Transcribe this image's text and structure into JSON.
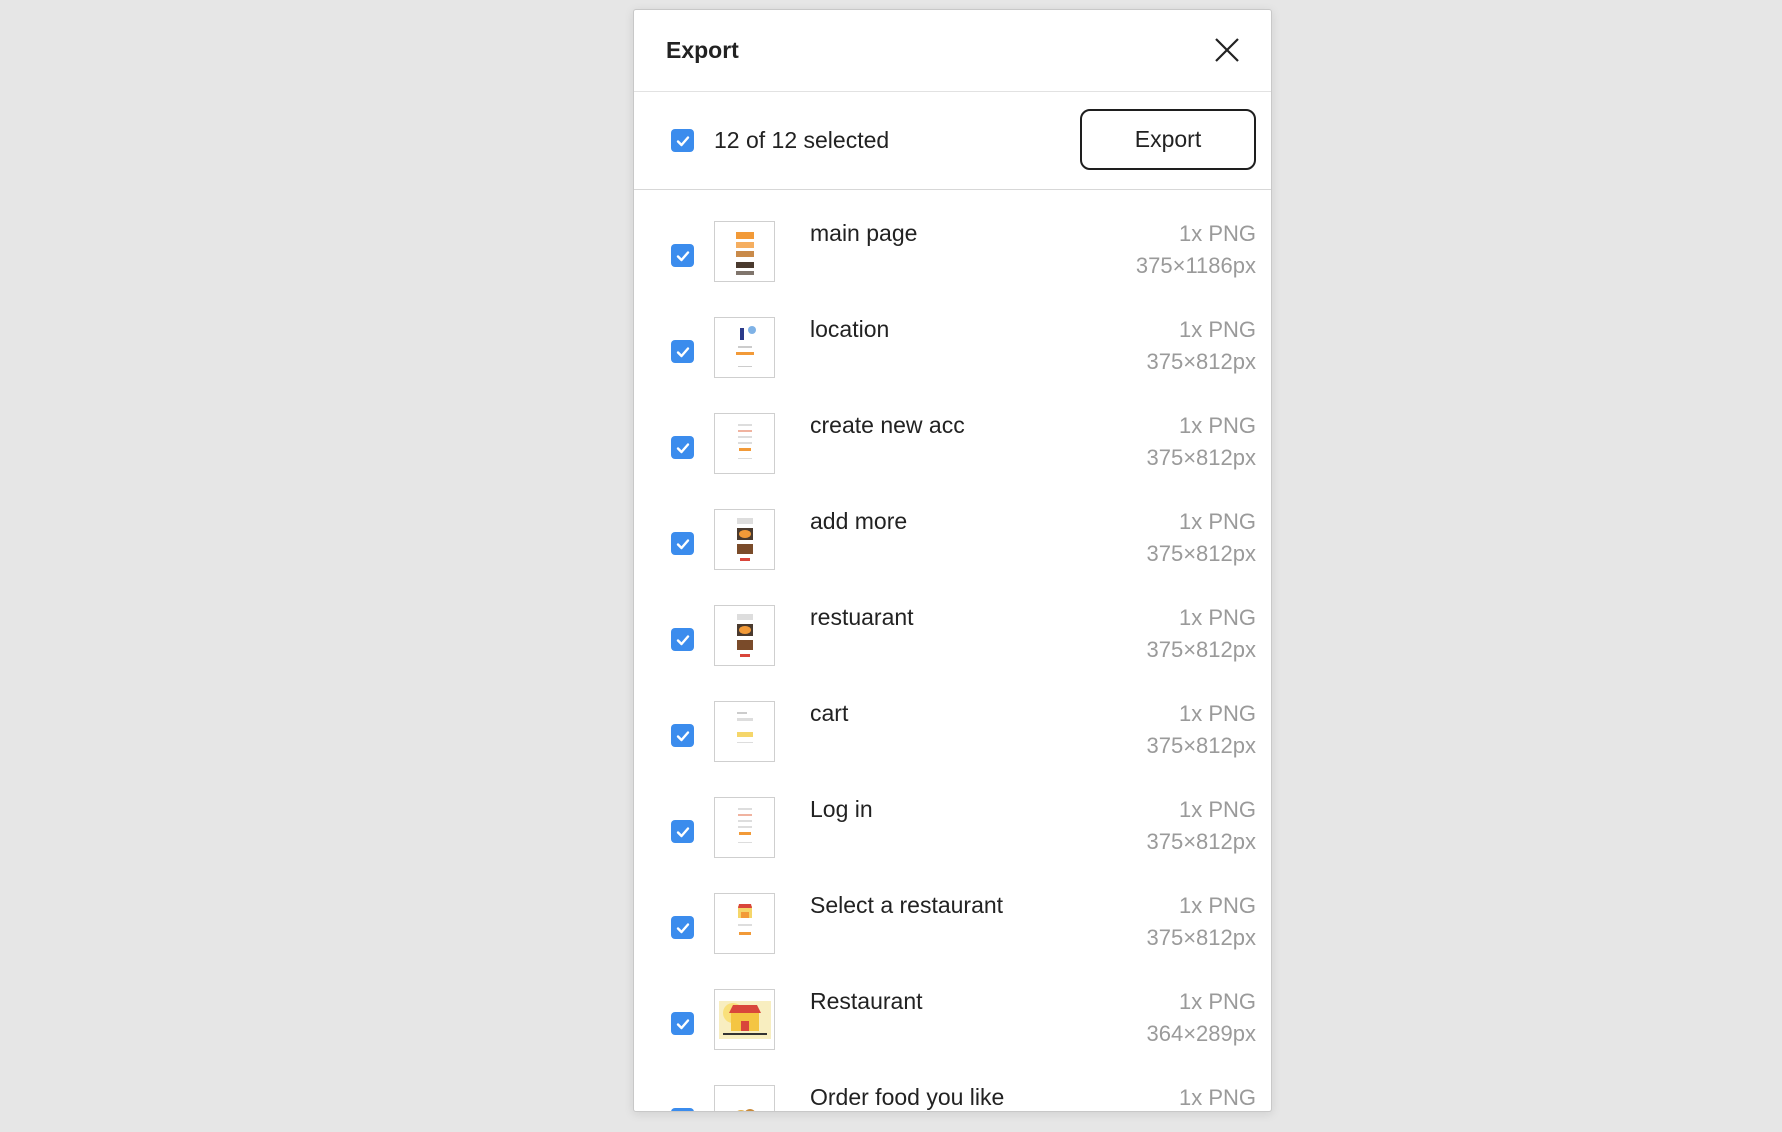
{
  "dialog": {
    "title": "Export",
    "selection_text": "12 of 12 selected",
    "export_label": "Export"
  },
  "colors": {
    "accent": "#3b8ced",
    "background": "#e6e6e6",
    "muted_text": "#9a9a9a"
  },
  "items": [
    {
      "name": "main page",
      "format": "1x PNG",
      "size": "375×1186px",
      "checked": true,
      "thumb": "tall-food-page"
    },
    {
      "name": "location",
      "format": "1x PNG",
      "size": "375×812px",
      "checked": true,
      "thumb": "location-illustration"
    },
    {
      "name": "create new acc",
      "format": "1x PNG",
      "size": "375×812px",
      "checked": true,
      "thumb": "form-page"
    },
    {
      "name": "add more",
      "format": "1x PNG",
      "size": "375×812px",
      "checked": true,
      "thumb": "food-image-page"
    },
    {
      "name": "restuarant",
      "format": "1x PNG",
      "size": "375×812px",
      "checked": true,
      "thumb": "food-image-page"
    },
    {
      "name": "cart",
      "format": "1x PNG",
      "size": "375×812px",
      "checked": true,
      "thumb": "cart-page"
    },
    {
      "name": "Log in",
      "format": "1x PNG",
      "size": "375×812px",
      "checked": true,
      "thumb": "form-page"
    },
    {
      "name": "Select a restaurant",
      "format": "1x PNG",
      "size": "375×812px",
      "checked": true,
      "thumb": "store-page"
    },
    {
      "name": "Restaurant",
      "format": "1x PNG",
      "size": "364×289px",
      "checked": true,
      "thumb": "store-illustration"
    },
    {
      "name": "Order food you like",
      "format": "1x PNG",
      "size": "",
      "checked": true,
      "thumb": "food-illustration"
    }
  ]
}
